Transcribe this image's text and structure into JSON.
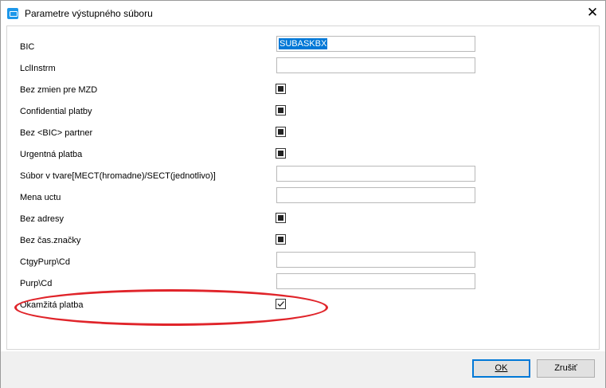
{
  "window": {
    "title": "Parametre výstupného súboru",
    "close_glyph": "✕"
  },
  "fields": [
    {
      "label": "BIC",
      "type": "text",
      "value": "SUBASKBX",
      "selected": true
    },
    {
      "label": "LclInstrm",
      "type": "text",
      "value": ""
    },
    {
      "label": "Bez zmien pre MZD",
      "type": "checkbox",
      "state": "indeterminate"
    },
    {
      "label": "Confidential platby",
      "type": "checkbox",
      "state": "indeterminate"
    },
    {
      "label": "Bez <BIC> partner",
      "type": "checkbox",
      "state": "indeterminate"
    },
    {
      "label": "Urgentná platba",
      "type": "checkbox",
      "state": "indeterminate"
    },
    {
      "label": "Súbor v tvare[MECT(hromadne)/SECT(jednotlivo)]",
      "type": "text",
      "value": ""
    },
    {
      "label": "Mena uctu",
      "type": "text",
      "value": ""
    },
    {
      "label": "Bez adresy",
      "type": "checkbox",
      "state": "indeterminate"
    },
    {
      "label": "Bez čas.značky",
      "type": "checkbox",
      "state": "indeterminate"
    },
    {
      "label": "CtgyPurp\\Cd",
      "type": "text",
      "value": ""
    },
    {
      "label": "Purp\\Cd",
      "type": "text",
      "value": ""
    },
    {
      "label": "Okamžitá platba",
      "type": "checkbox",
      "state": "checked"
    }
  ],
  "buttons": {
    "ok": "OK",
    "cancel": "Zrušiť"
  },
  "colors": {
    "highlight": "#e0242a",
    "selection": "#0078d7",
    "app_icon": "#1c97ea"
  }
}
